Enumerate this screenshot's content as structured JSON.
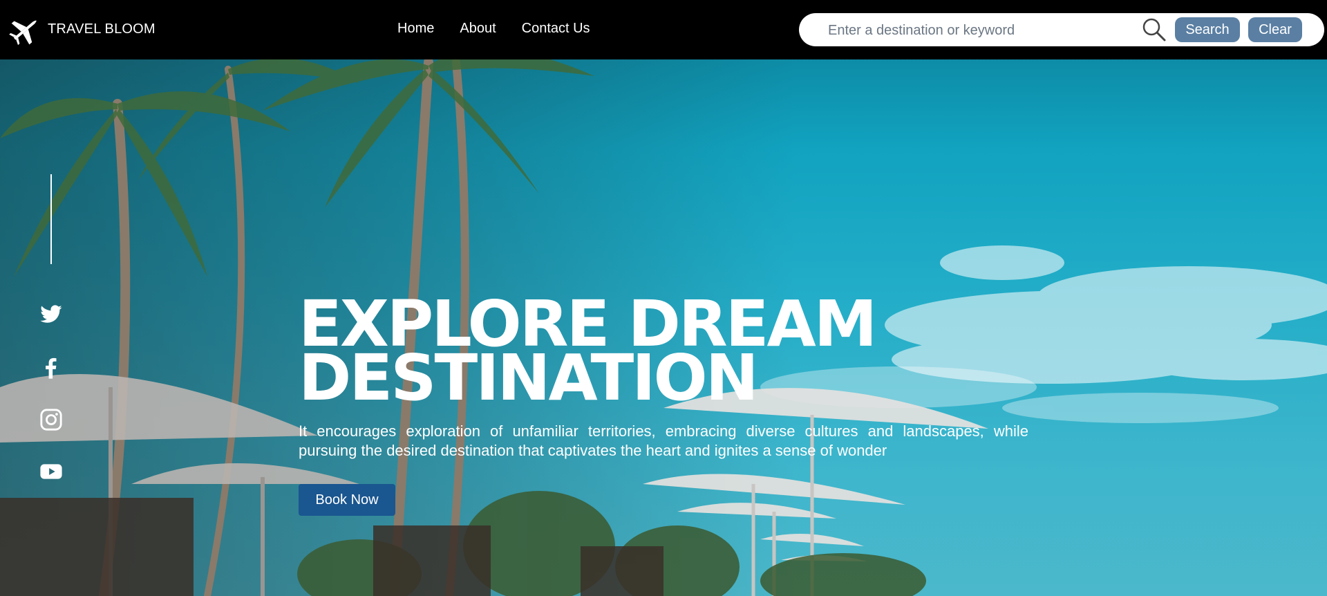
{
  "brand": {
    "name": "TRAVEL BLOOM",
    "logo_icon": "airplane-icon"
  },
  "nav": {
    "links": [
      {
        "label": "Home"
      },
      {
        "label": "About"
      },
      {
        "label": "Contact Us"
      }
    ]
  },
  "search": {
    "placeholder": "Enter a destination or keyword",
    "value": "",
    "icon": "search-icon",
    "search_label": "Search",
    "clear_label": "Clear"
  },
  "social": {
    "icons": [
      "twitter-icon",
      "facebook-icon",
      "instagram-icon",
      "youtube-icon"
    ]
  },
  "hero": {
    "title": "EXPLORE DREAM DESTINATION",
    "description": "It encourages exploration of unfamiliar territories, embracing diverse cultures and landscapes, while pursuing the desired destination that captivates the heart and ignites a sense of wonder",
    "cta_label": "Book Now"
  },
  "colors": {
    "navbar_bg": "#000000",
    "button_bg": "#5a7fa3",
    "cta_bg": "#1a5690",
    "sky": "#11a3c0"
  }
}
